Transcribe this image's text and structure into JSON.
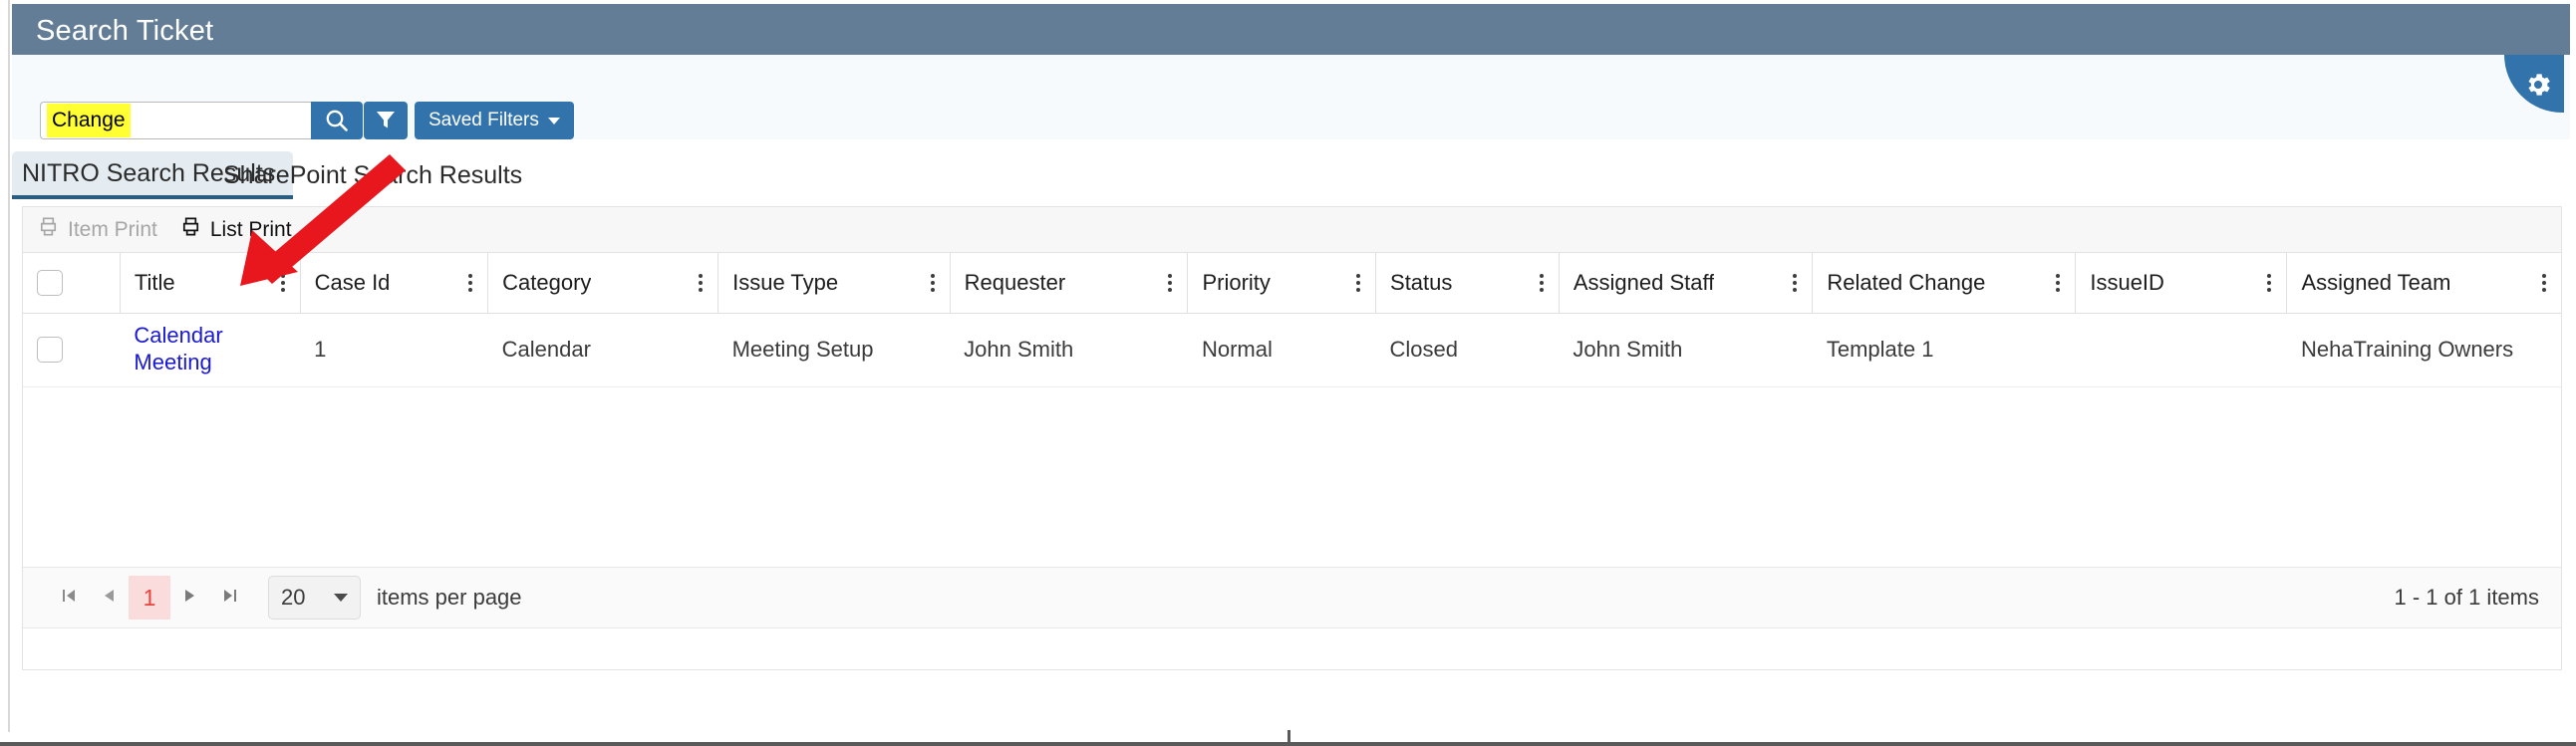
{
  "window": {
    "title": "Search Ticket"
  },
  "search": {
    "query_token": "Change",
    "search_icon": "search-icon",
    "filter_icon": "funnel-icon",
    "saved_filters_label": "Saved Filters",
    "gear_icon": "gear-icon"
  },
  "tabs": [
    {
      "label": "NITRO Search Results",
      "active": true
    },
    {
      "label": "SharePoint Search Results",
      "active": false
    }
  ],
  "toolbar": {
    "item_print_label": "Item Print",
    "item_print_icon": "printer-icon",
    "item_print_disabled": true,
    "list_print_label": "List Print",
    "list_print_icon": "printer-icon",
    "list_print_disabled": false
  },
  "grid": {
    "columns": [
      "Title",
      "Case Id",
      "Category",
      "Issue Type",
      "Requester",
      "Priority",
      "Status",
      "Assigned Staff",
      "Related Change",
      "IssueID",
      "Assigned Team"
    ],
    "rows": [
      {
        "title": "Calendar Meeting",
        "case_id": "1",
        "category": "Calendar",
        "issue_type": "Meeting Setup",
        "requester": "John Smith",
        "priority": "Normal",
        "status": "Closed",
        "assigned_staff": "John Smith",
        "related_change": "Template 1",
        "issue_id": "",
        "assigned_team": "NehaTraining Owners"
      }
    ]
  },
  "pager": {
    "first_icon": "first-page-icon",
    "prev_icon": "previous-page-icon",
    "current_page": "1",
    "next_icon": "next-page-icon",
    "last_icon": "last-page-icon",
    "page_size": "20",
    "per_page_label": "items per page",
    "summary": "1 - 1 of 1 items"
  },
  "colors": {
    "title_bar": "#647d96",
    "accent_blue": "#3273ac",
    "highlight_yellow": "#ffff33",
    "link_blue": "#1a19d6",
    "active_tab_bg": "#e4ecf2",
    "active_tab_underline": "#2b5d80",
    "pager_active_bg": "#fbdcdc",
    "pager_active_text": "#e8453c",
    "annotation_red": "#e8161d"
  }
}
